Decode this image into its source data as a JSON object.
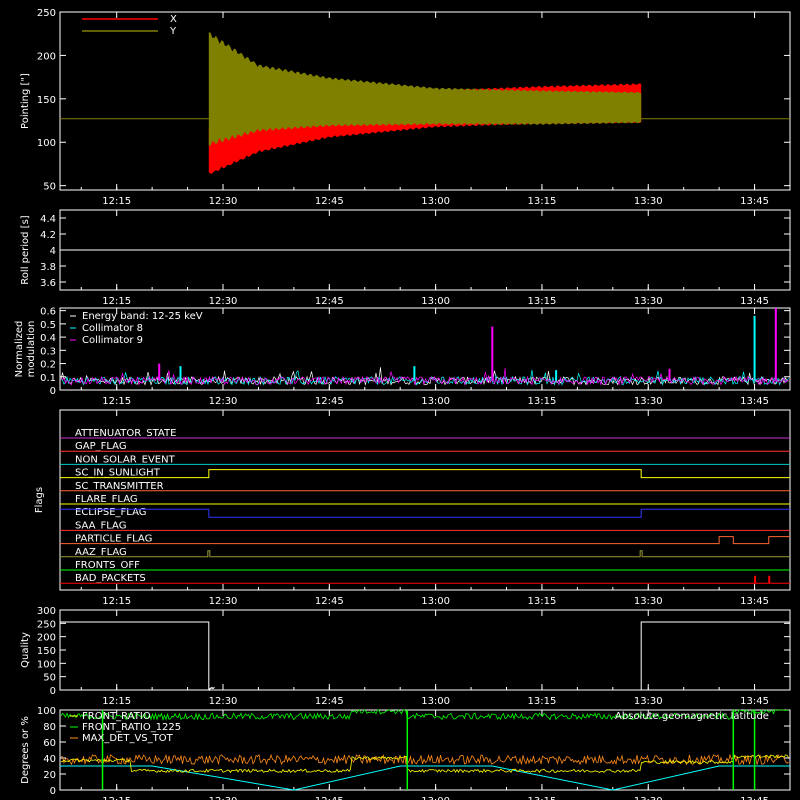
{
  "chart_data": [
    {
      "id": "pointing",
      "type": "line",
      "ylabel": "Pointing [\"]",
      "ylim": [
        45,
        250
      ],
      "yticks": [
        50,
        100,
        150,
        200,
        250
      ],
      "legend": [
        {
          "name": "X",
          "color": "#ff0000"
        },
        {
          "name": "Y",
          "color": "#808000"
        }
      ],
      "baseline": 127,
      "active_span": [
        "12:28",
        "13:29"
      ],
      "series": [
        {
          "name": "X",
          "color": "#ff0000",
          "envelope": [
            {
              "t": "12:28",
              "lo": 62,
              "hi": 120
            },
            {
              "t": "12:35",
              "lo": 88,
              "hi": 138
            },
            {
              "t": "12:45",
              "lo": 105,
              "hi": 150
            },
            {
              "t": "13:00",
              "lo": 117,
              "hi": 160
            },
            {
              "t": "13:15",
              "lo": 121,
              "hi": 165
            },
            {
              "t": "13:29",
              "lo": 122,
              "hi": 168
            }
          ]
        },
        {
          "name": "Y",
          "color": "#808000",
          "envelope": [
            {
              "t": "12:28",
              "lo": 95,
              "hi": 228
            },
            {
              "t": "12:35",
              "lo": 112,
              "hi": 190
            },
            {
              "t": "12:45",
              "lo": 118,
              "hi": 175
            },
            {
              "t": "13:00",
              "lo": 120,
              "hi": 163
            },
            {
              "t": "13:15",
              "lo": 120,
              "hi": 160
            },
            {
              "t": "13:29",
              "lo": 122,
              "hi": 158
            }
          ]
        }
      ]
    },
    {
      "id": "roll",
      "type": "line",
      "ylabel": "Roll period [s]",
      "ylim": [
        3.5,
        4.5
      ],
      "yticks": [
        3.6,
        3.8,
        4.0,
        4.2,
        4.4
      ],
      "value": 4.0
    },
    {
      "id": "modulation",
      "type": "bar",
      "ylabel": [
        "Normalized",
        "modulation"
      ],
      "ylim": [
        0,
        0.62
      ],
      "yticks": [
        0.0,
        0.1,
        0.2,
        0.3,
        0.4,
        0.5,
        0.6
      ],
      "legend": [
        {
          "name": "Energy band: 12-25 keV",
          "color": "#ffffff"
        },
        {
          "name": "Collimator 8",
          "color": "#00ffff"
        },
        {
          "name": "Collimator 9",
          "color": "#ff00ff"
        }
      ],
      "baseline": 0.07,
      "spikes": [
        {
          "t": "12:21",
          "v": 0.2,
          "series": "Collimator 9"
        },
        {
          "t": "12:24",
          "v": 0.18,
          "series": "Collimator 8"
        },
        {
          "t": "12:57",
          "v": 0.18,
          "series": "Collimator 8"
        },
        {
          "t": "13:08",
          "v": 0.48,
          "series": "Collimator 9"
        },
        {
          "t": "13:17",
          "v": 0.15,
          "series": "Collimator 8"
        },
        {
          "t": "13:33",
          "v": 0.16,
          "series": "Collimator 9"
        },
        {
          "t": "13:45",
          "v": 0.56,
          "series": "Collimator 8"
        },
        {
          "t": "13:48",
          "v": 0.62,
          "series": "Collimator 9"
        }
      ]
    },
    {
      "id": "flags",
      "type": "line",
      "ylabel": "Flags",
      "rows": [
        {
          "label": "ATTENUATOR_STATE",
          "color": "#cc33cc"
        },
        {
          "label": "GAP_FLAG",
          "color": "#ff3333"
        },
        {
          "label": "NON_SOLAR_EVENT",
          "color": "#00cccc"
        },
        {
          "label": "SC_IN_SUNLIGHT",
          "color": "#ffff00"
        },
        {
          "label": "SC_TRANSMITTER",
          "color": "#ff6633"
        },
        {
          "label": "FLARE_FLAG",
          "color": "#ffff00"
        },
        {
          "label": "ECLIPSE_FLAG",
          "color": "#3333ff"
        },
        {
          "label": "SAA_FLAG",
          "color": "#ff3333"
        },
        {
          "label": "PARTICLE_FLAG",
          "color": "#ff6633"
        },
        {
          "label": "AAZ_FLAG",
          "color": "#999933"
        },
        {
          "label": "FRONTS_OFF",
          "color": "#00ff00"
        },
        {
          "label": "BAD_PACKETS",
          "color": "#ff0000"
        }
      ]
    },
    {
      "id": "quality",
      "type": "line",
      "ylabel": "Quality",
      "ylim": [
        0,
        300
      ],
      "yticks": [
        0,
        50,
        100,
        150,
        200,
        250,
        300
      ],
      "points": [
        {
          "t": "12:07",
          "v": 255
        },
        {
          "t": "12:28",
          "v": 255
        },
        {
          "t": "12:28",
          "v": 0
        },
        {
          "t": "13:29",
          "v": 0
        },
        {
          "t": "13:29",
          "v": 255
        },
        {
          "t": "13:50",
          "v": 255
        }
      ]
    },
    {
      "id": "ratios",
      "type": "line",
      "ylabel": "Degrees or %",
      "ylim": [
        0,
        100
      ],
      "yticks": [
        0,
        20,
        40,
        60,
        80,
        100
      ],
      "legend": [
        {
          "name": "FRONT_RATIO",
          "color": "#ffff00"
        },
        {
          "name": "FRONT_RATIO_1225",
          "color": "#00ff00"
        },
        {
          "name": "MAX_DET_VS_TOT",
          "color": "#ff8c1a"
        },
        {
          "name": "Absolute geomagnetic latitude",
          "color": "#00ffff"
        }
      ],
      "series": [
        {
          "name": "Absolute geomagnetic latitude",
          "color": "#00ffff",
          "x": [
            "12:07",
            "12:20",
            "12:40",
            "12:55",
            "13:08",
            "13:25",
            "13:40",
            "13:50"
          ],
          "y": [
            30,
            30,
            0,
            30,
            30,
            0,
            30,
            30
          ]
        }
      ]
    }
  ],
  "time_axis": {
    "xlim": [
      "12:07",
      "13:50"
    ],
    "ticks": [
      "12:15",
      "12:30",
      "12:45",
      "13:00",
      "13:15",
      "13:30",
      "13:45"
    ]
  }
}
